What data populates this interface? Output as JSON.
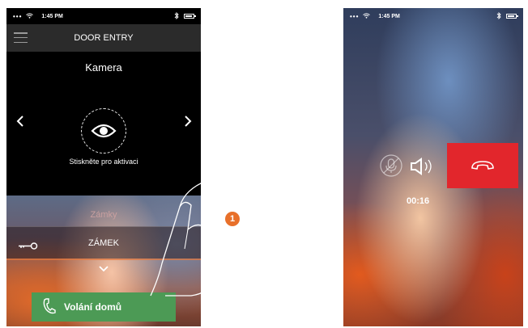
{
  "left_screen": {
    "status": {
      "dots": "•••",
      "time": "1:45 PM"
    },
    "header": {
      "title": "DOOR ENTRY"
    },
    "camera": {
      "title": "Kamera",
      "hint": "Stiskněte pro aktivaci"
    },
    "locks": {
      "title": "Zámky",
      "lock_label": "ZÁMEK"
    },
    "call_button": {
      "label": "Volání domů"
    },
    "step_badge": "1"
  },
  "right_screen": {
    "status": {
      "dots": "•••",
      "time": "1:45 PM"
    },
    "call_timer": "00:16"
  },
  "colors": {
    "call_button": "#4c9a55",
    "hangup_button": "#e2262c",
    "step_badge": "#e8702a",
    "header_bar": "#2b2b2b"
  },
  "icons": [
    "hamburger-menu-icon",
    "eye-icon",
    "chevron-left-icon",
    "chevron-right-icon",
    "key-icon",
    "chevron-down-icon",
    "phone-handset-icon",
    "microphone-off-icon",
    "speaker-icon",
    "hang-up-icon",
    "bluetooth-icon",
    "battery-icon",
    "wifi-icon"
  ]
}
